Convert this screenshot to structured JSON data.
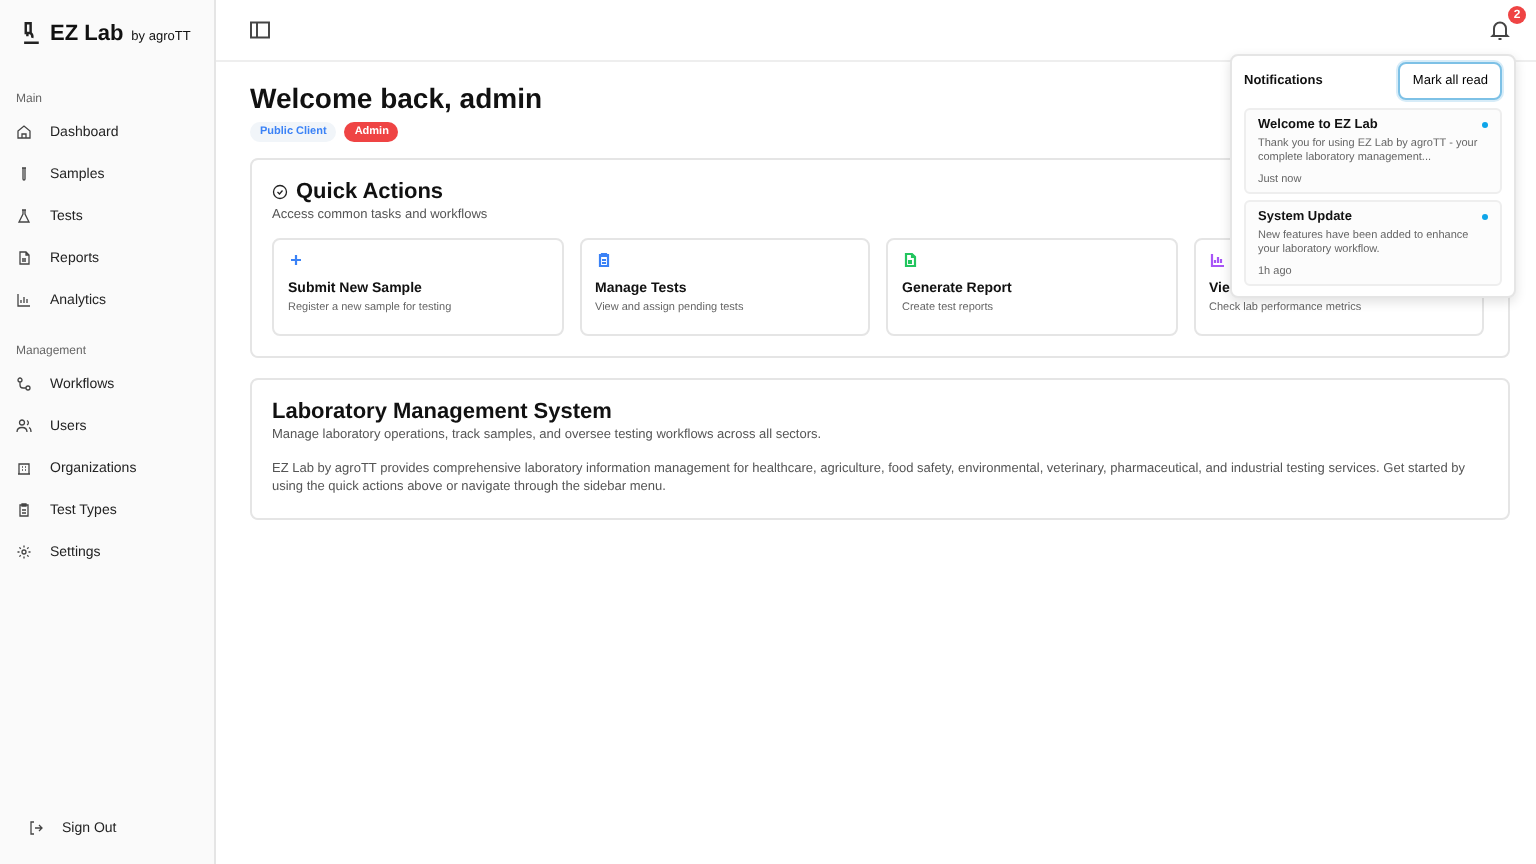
{
  "brand": {
    "name": "EZ Lab",
    "byline": "by agroTT"
  },
  "sidebar": {
    "sections": [
      {
        "title": "Main",
        "items": [
          {
            "label": "Dashboard"
          },
          {
            "label": "Samples"
          },
          {
            "label": "Tests"
          },
          {
            "label": "Reports"
          },
          {
            "label": "Analytics"
          }
        ]
      },
      {
        "title": "Management",
        "items": [
          {
            "label": "Workflows"
          },
          {
            "label": "Users"
          },
          {
            "label": "Organizations"
          },
          {
            "label": "Test Types"
          },
          {
            "label": "Settings"
          }
        ]
      }
    ],
    "sign_out": "Sign Out"
  },
  "notification_badge": "2",
  "welcome": {
    "title": "Welcome back, admin",
    "badges": [
      {
        "label": "Public Client",
        "kind": "soft"
      },
      {
        "label": "Admin",
        "kind": "danger"
      }
    ]
  },
  "quick_actions": {
    "title": "Quick Actions",
    "subtitle": "Access common tasks and workflows",
    "actions": [
      {
        "color": "#3b82f6",
        "title": "Submit New Sample",
        "description": "Register a new sample for testing"
      },
      {
        "color": "#3b82f6",
        "title": "Manage Tests",
        "description": "View and assign pending tests"
      },
      {
        "color": "#22c55e",
        "title": "Generate Report",
        "description": "Create test reports"
      },
      {
        "color": "#a855f7",
        "title": "Vie",
        "description": "Check lab performance metrics"
      }
    ]
  },
  "info": {
    "title": "Laboratory Management System",
    "subtitle": "Manage laboratory operations, track samples, and oversee testing workflows across all sectors.",
    "body": "EZ Lab by agroTT provides comprehensive laboratory information management for healthcare, agriculture, food safety, environmental, veterinary, pharmaceutical, and industrial testing services. Get started by using the quick actions above or navigate through the sidebar menu."
  },
  "notifications": {
    "title": "Notifications",
    "action": "Mark all read",
    "items": [
      {
        "title": "Welcome to EZ Lab",
        "text": "Thank you for using EZ Lab by agroTT - your complete laboratory management...",
        "time": "Just now",
        "unread": true
      },
      {
        "title": "System Update",
        "text": "New features have been added to enhance your laboratory workflow.",
        "time": "1h ago",
        "unread": true
      }
    ]
  }
}
